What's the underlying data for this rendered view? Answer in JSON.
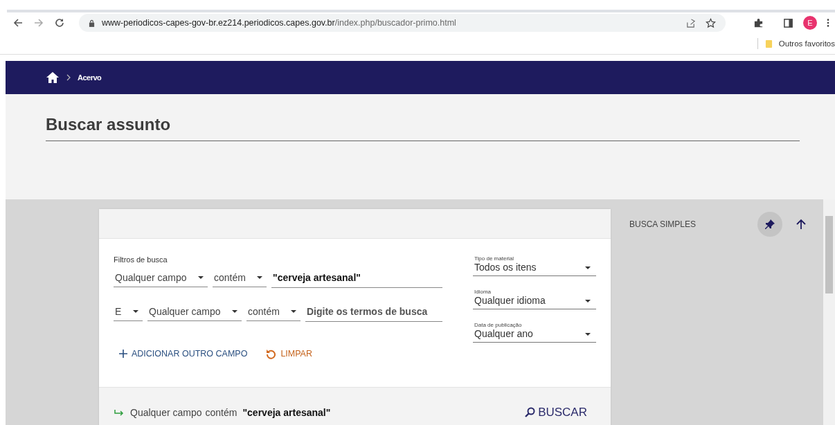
{
  "browser": {
    "url_host": "www-periodicos-capes-gov-br.ez214.periodicos.capes.gov.br",
    "url_path": "/index.php/buscador-primo.html",
    "profile_initial": "E",
    "bookmark": "Outros favoritos"
  },
  "breadcrumb": [
    "Acervo"
  ],
  "page_title": "Buscar assunto",
  "search": {
    "label": "Filtros de busca",
    "rows": [
      {
        "field": "Qualquer campo",
        "condition": "contém",
        "value": "\"cerveja artesanal\""
      },
      {
        "operator": "E",
        "field": "Qualquer campo",
        "condition": "contém",
        "placeholder": "Digite os termos de busca"
      }
    ],
    "add_label": "ADICIONAR OUTRO CAMPO",
    "clear_label": "LIMPAR"
  },
  "filters": [
    {
      "label": "Tipo de material",
      "value": "Todos os itens"
    },
    {
      "label": "Idioma",
      "value": "Qualquer idioma"
    },
    {
      "label": "Data de publicação",
      "value": "Qualquer ano"
    }
  ],
  "summary": {
    "field": "Qualquer campo",
    "condition": "contém",
    "value": "\"cerveja artesanal\""
  },
  "search_button": "BUSCAR",
  "side_title": "BUSCA SIMPLES"
}
